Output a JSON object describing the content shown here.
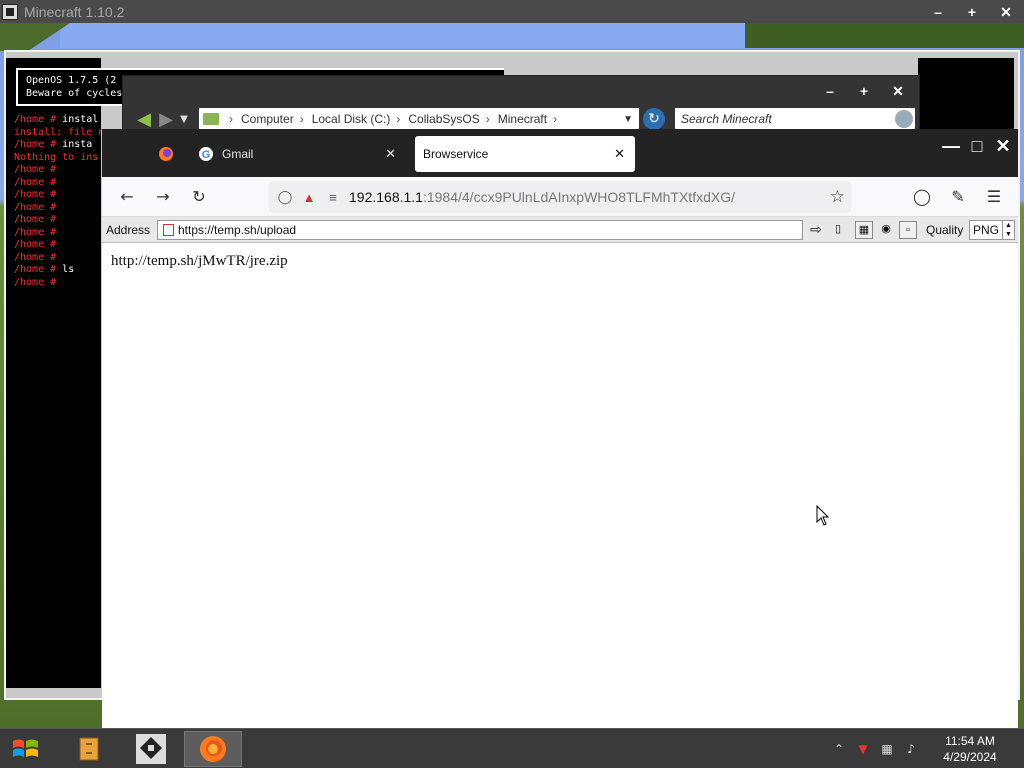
{
  "minecraft": {
    "title": "Minecraft 1.10.2",
    "ctrl_min": "–",
    "ctrl_max": "+",
    "ctrl_close": "✕"
  },
  "terminal": {
    "header_line1": "OpenOS 1.7.5 (2",
    "header_line2": "Beware of cycles",
    "lines": [
      {
        "text": "/home # ",
        "extra": "instal",
        "color": "red"
      },
      {
        "text": "install: file n",
        "extra": "",
        "color": "red"
      },
      {
        "text": "/home # ",
        "extra": "insta",
        "color": "red"
      },
      {
        "text": "Nothing to ins",
        "extra": "",
        "color": "red"
      },
      {
        "text": "/home #",
        "extra": "",
        "color": "red"
      },
      {
        "text": "/home #",
        "extra": "",
        "color": "red"
      },
      {
        "text": "/home #",
        "extra": "",
        "color": "red"
      },
      {
        "text": "/home #",
        "extra": "",
        "color": "red"
      },
      {
        "text": "/home #",
        "extra": "",
        "color": "red"
      },
      {
        "text": "/home #",
        "extra": "",
        "color": "red"
      },
      {
        "text": "/home #",
        "extra": "",
        "color": "red"
      },
      {
        "text": "/home #",
        "extra": "",
        "color": "red"
      },
      {
        "text": "/home # ",
        "extra": "ls",
        "color": "red"
      },
      {
        "text": "/home #",
        "extra": "",
        "color": "red"
      }
    ]
  },
  "explorer": {
    "breadcrumb": [
      "Computer",
      "Local Disk (C:)",
      "CollabSysOS",
      "Minecraft"
    ],
    "search_placeholder": "Search Minecraft",
    "ctrl_min": "–",
    "ctrl_max": "+",
    "ctrl_close": "✕"
  },
  "firefox": {
    "tabs": [
      {
        "label": "Gmail",
        "close": "✕"
      },
      {
        "label": "Browservice",
        "close": "✕"
      }
    ],
    "url_host": "192.168.1.1",
    "url_path": ":1984/4/ccx9PUlnLdAInxpWHO8TLFMhTXtfxdXG/",
    "ctrl_min": "—",
    "ctrl_max": "□",
    "ctrl_close": "✕"
  },
  "browservice": {
    "address_label": "Address",
    "address_value": "https://temp.sh/upload",
    "quality_label": "Quality",
    "quality_value": "PNG"
  },
  "page": {
    "text": "http://temp.sh/jMwTR/jre.zip"
  },
  "taskbar": {
    "time": "11:54 AM",
    "date": "4/29/2024"
  }
}
